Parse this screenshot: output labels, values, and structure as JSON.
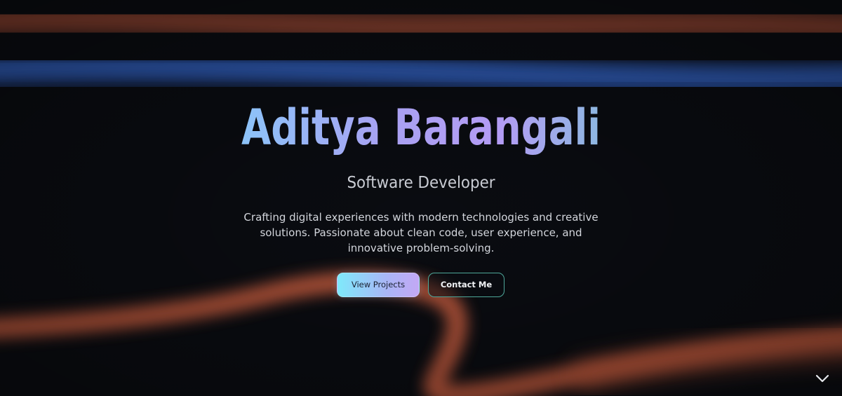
{
  "hero": {
    "name": "Aditya Barangali",
    "role": "Software Developer",
    "description": "Crafting digital experiences with modern technologies and creative solutions. Passionate about clean code, user experience, and innovative problem-solving.",
    "buttons": {
      "primary_label": "View Projects",
      "secondary_label": "Contact Me"
    },
    "scroll_icon": "chevron-down-icon"
  },
  "colors": {
    "background": "#0a0c11",
    "accent_orange": "#c75a3a",
    "accent_blue": "#2f5fbf",
    "name_gradient_start": "#6fe6ff",
    "name_gradient_mid": "#b39cf4",
    "name_gradient_end": "#56e0c5",
    "secondary_button_border": "#4ea89a"
  }
}
